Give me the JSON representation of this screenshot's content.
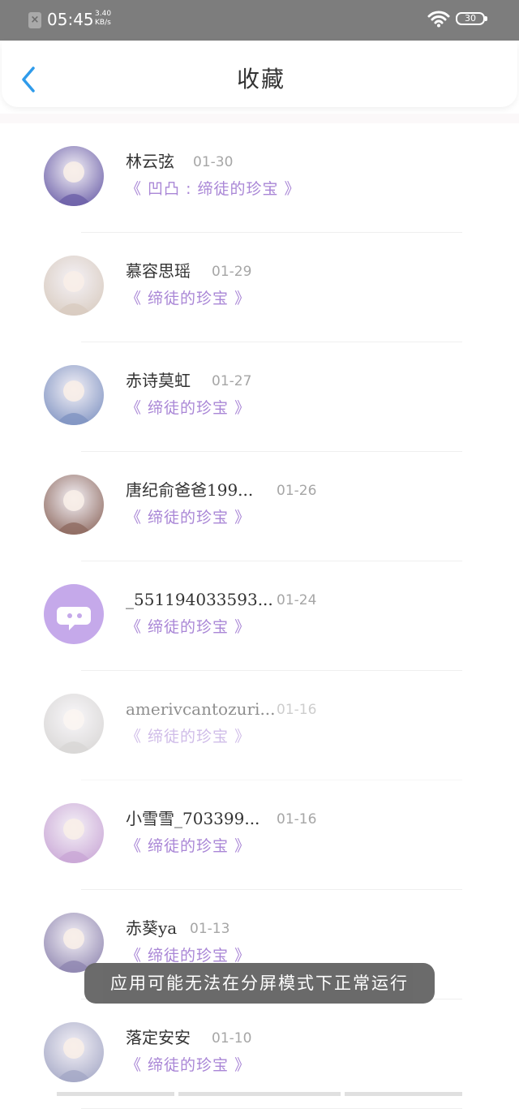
{
  "status_bar": {
    "time": "05:45",
    "speed_value": "3.40",
    "speed_unit": "KB/s",
    "battery": "30"
  },
  "header": {
    "title": "收藏"
  },
  "items": [
    {
      "name": "林云弦",
      "date": "01-30",
      "work": "《 凹凸 : 缔徒的珍宝 》",
      "avatar_color": "#6b5fa8"
    },
    {
      "name": "慕容思瑶",
      "date": "01-29",
      "work": "《 缔徒的珍宝 》",
      "avatar_color": "#d8cbbf"
    },
    {
      "name": "赤诗莫虹",
      "date": "01-27",
      "work": "《 缔徒的珍宝 》",
      "avatar_color": "#7f93c2"
    },
    {
      "name": "唐纪俞爸爸199...",
      "date": "01-26",
      "work": "《 缔徒的珍宝 》",
      "avatar_color": "#8e6a60"
    },
    {
      "name": "_551194033593...",
      "date": "01-24",
      "work": "《 缔徒的珍宝 》",
      "avatar_color": "#c5a9ea"
    },
    {
      "name": "amerivcantozuri...",
      "date": "01-16",
      "work": "《 缔徒的珍宝 》",
      "avatar_color": "#b9b6b4"
    },
    {
      "name": "小雪雪_703399...",
      "date": "01-16",
      "work": "《 缔徒的珍宝 》",
      "avatar_color": "#c9a6d6"
    },
    {
      "name": "赤葵ya",
      "date": "01-13",
      "work": "《 缔徒的珍宝 》",
      "avatar_color": "#8f86b0"
    },
    {
      "name": "落定安安",
      "date": "01-10",
      "work": "《 缔徒的珍宝 》",
      "avatar_color": "#a4a8c6"
    }
  ],
  "toast": {
    "text": "应用可能无法在分屏模式下正常运行"
  },
  "colors": {
    "accent": "#2f9bea",
    "work_text": "#a986d6",
    "status_bar": "#7d7d7d"
  }
}
